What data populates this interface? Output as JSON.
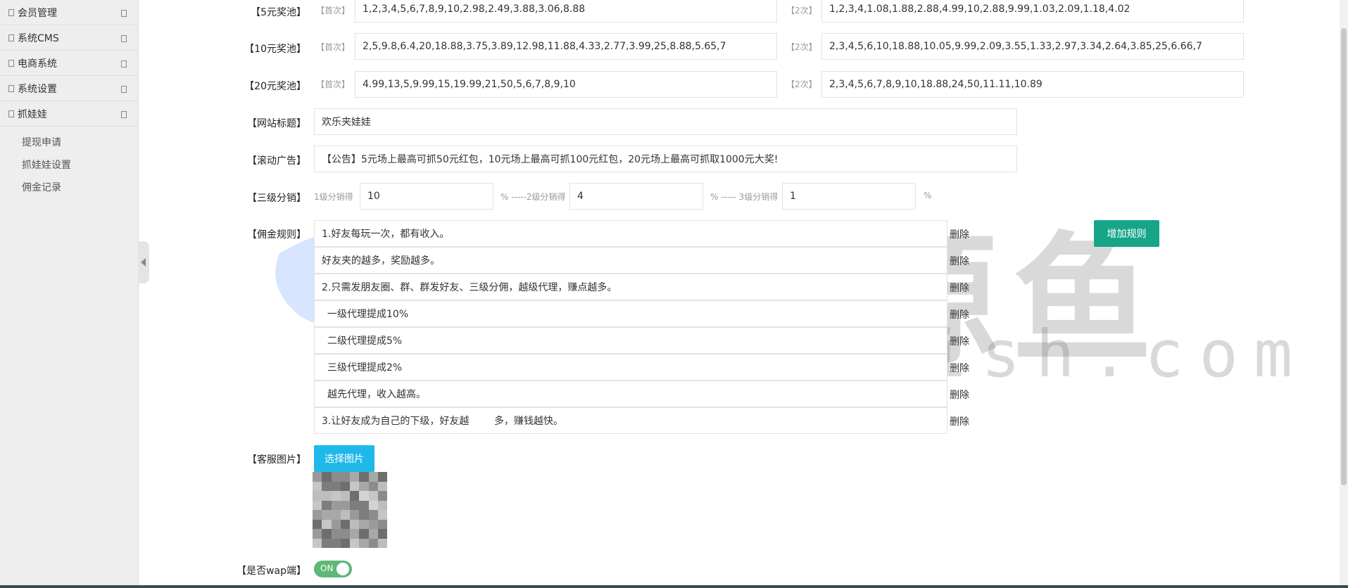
{
  "sidebar": {
    "items": [
      {
        "label": "会员管理"
      },
      {
        "label": "系统CMS"
      },
      {
        "label": "电商系统"
      },
      {
        "label": "系统设置"
      },
      {
        "label": "抓娃娃"
      }
    ],
    "sub_items": [
      {
        "label": "提现申请"
      },
      {
        "label": "抓娃娃设置"
      },
      {
        "label": "佣金记录"
      }
    ]
  },
  "pools": [
    {
      "label": "【5元奖池】",
      "first_tag": "【首次】",
      "first_value": "1,2,3,4,5,6,7,8,9,10,2.98,2.49,3.88,3.06,8.88",
      "second_tag": "【2次】",
      "second_value": "1,2,3,4,1.08,1.88,2.88,4.99,10,2.88,9.99,1.03,2.09,1.18,4.02"
    },
    {
      "label": "【10元奖池】",
      "first_tag": "【首次】",
      "first_value": "2,5,9.8,6.4,20,18.88,3.75,3.89,12.98,11.88,4.33,2.77,3.99,25,8.88,5.65,7",
      "second_tag": "【2次】",
      "second_value": "2,3,4,5,6,10,18.88,10.05,9.99,2.09,3.55,1.33,2.97,3.34,2.64,3.85,25,6.66,7"
    },
    {
      "label": "【20元奖池】",
      "first_tag": "【首次】",
      "first_value": "4.99,13,5,9.99,15,19.99,21,50,5,6,7,8,9,10",
      "second_tag": "【2次】",
      "second_value": "2,3,4,5,6,7,8,9,10,18.88,24,50,11.11,10.89"
    }
  ],
  "site_title": {
    "label": "【网站标题】",
    "value": "欢乐夹娃娃"
  },
  "scroll_ad": {
    "label": "【滚动广告】",
    "value": "【公告】5元场上最高可抓50元红包，10元场上最高可抓100元红包，20元场上最高可抓取1000元大奖!"
  },
  "distribution": {
    "label": "【三级分销】",
    "level1_hint": "1级分销得",
    "level1_value": "10",
    "level2_hint": "% -----2级分销得",
    "level2_value": "4",
    "level3_hint": "% ----- 3级分销得",
    "level3_value": "1",
    "pct": "%"
  },
  "rules": {
    "label": "【佣金规则】",
    "add_label": "增加规则",
    "delete_label": "删除",
    "items": [
      "1.好友每玩一次，都有收入。",
      "好友夹的越多，奖励越多。",
      "2.只需发朋友圈、群、群发好友、三级分佣，越级代理，赚点越多。",
      "  一级代理提成10%",
      "  二级代理提成5%",
      "  三级代理提成2%",
      "  越先代理，收入越高。",
      "3.让好友成为自己的下级，好友越        多，赚钱越快。"
    ]
  },
  "service_image": {
    "label": "【客服图片】",
    "button": "选择图片"
  },
  "wap": {
    "label": "【是否wap端】",
    "toggle": "ON"
  },
  "watermark": {
    "main": "资源鱼",
    "sub": "resfish.com"
  }
}
